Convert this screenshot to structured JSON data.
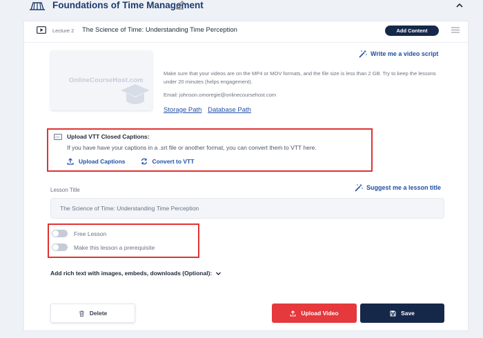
{
  "section": {
    "title": "Foundations of Time Management",
    "icon": "book-stack-icon"
  },
  "lecture": {
    "number": "Lecture 2",
    "title": "The Science of Time: Understanding Time Perception",
    "add_content_label": "Add Content"
  },
  "video": {
    "thumbnail_logo": "OnlineCourseHost.com",
    "script_link": "Write me a video script",
    "info_text": "Make sure that your videos are on the MP4 or MOV formats, and the file size is less than 2 GB. Try to keep the lessons under 20 minutes (helps engagement).",
    "email_line": "Email: johnson.omoregie@onlinecoursehost.com",
    "storage_path": "Storage Path",
    "database_path": "Database Path"
  },
  "captions": {
    "title": "Upload VTT Closed Captions:",
    "description": "If you have have your captions in a .srt file or another format, you can convert them to VTT here.",
    "upload_label": "Upload Captions",
    "convert_label": "Convert to VTT"
  },
  "lesson": {
    "title_label": "Lesson Title",
    "suggest_link": "Suggest me a lesson title",
    "title_value": "The Science of Time: Understanding Time Perception"
  },
  "toggles": {
    "free_lesson": "Free Lesson",
    "prerequisite": "Make this lesson a prerequisite"
  },
  "rich_text_label": "Add rich text with images, embeds, downloads (Optional):",
  "buttons": {
    "delete": "Delete",
    "upload_video": "Upload Video",
    "save": "Save"
  },
  "colors": {
    "accent": "#1f4fa5",
    "primary_dark": "#16284a",
    "danger": "#e5393d",
    "highlight_border": "#e03131"
  }
}
